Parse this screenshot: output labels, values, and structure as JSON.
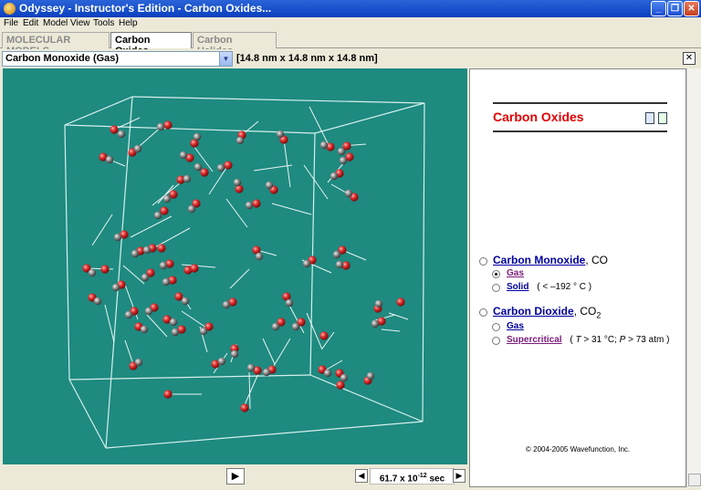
{
  "window": {
    "title": "Odyssey - Instructor's Edition - Carbon Oxides...",
    "minimize": "_",
    "maximize": "❐",
    "close": "✕"
  },
  "menu": [
    "File",
    "Edit",
    "Model",
    "View",
    "Tools",
    "Help"
  ],
  "tabs": [
    "MOLECULAR MODELS",
    "Carbon Oxides...",
    "Carbon Halides..."
  ],
  "model_select": {
    "value": "Carbon Monoxide (Gas)"
  },
  "dimensions": "[14.8 nm x 14.8 nm x 14.8 nm]",
  "panel_close": "✕",
  "playback": {
    "play_icon": "▶",
    "step_back_icon": "◀",
    "step_fwd_icon": "▶",
    "time_value": "61.7 x 10",
    "time_exp": "-12",
    "time_unit": " sec"
  },
  "rightpane": {
    "title": "Carbon Oxides",
    "compounds": [
      {
        "name": "Carbon Monoxide",
        "formula": "CO",
        "phases": [
          {
            "label": "Gas",
            "selected": true,
            "visited": true
          },
          {
            "label": "Solid",
            "note": "( < –192 ° C )"
          }
        ]
      },
      {
        "name": "Carbon Dioxide",
        "formula": "CO",
        "formula_sub": "2",
        "phases": [
          {
            "label": "Gas"
          },
          {
            "label": "Supercritical",
            "visited": true,
            "note_parts": [
              "( ",
              "T",
              " > 31 °C; ",
              "P",
              " > 73 atm )"
            ]
          }
        ]
      }
    ],
    "copyright": "© 2004-2005  Wavefunction, Inc."
  },
  "colors": {
    "viewport_bg": "#1e8a80",
    "oxygen": "#e03030",
    "carbon": "#8a8a8a",
    "title_red": "#e00000",
    "link": "#00009c"
  }
}
